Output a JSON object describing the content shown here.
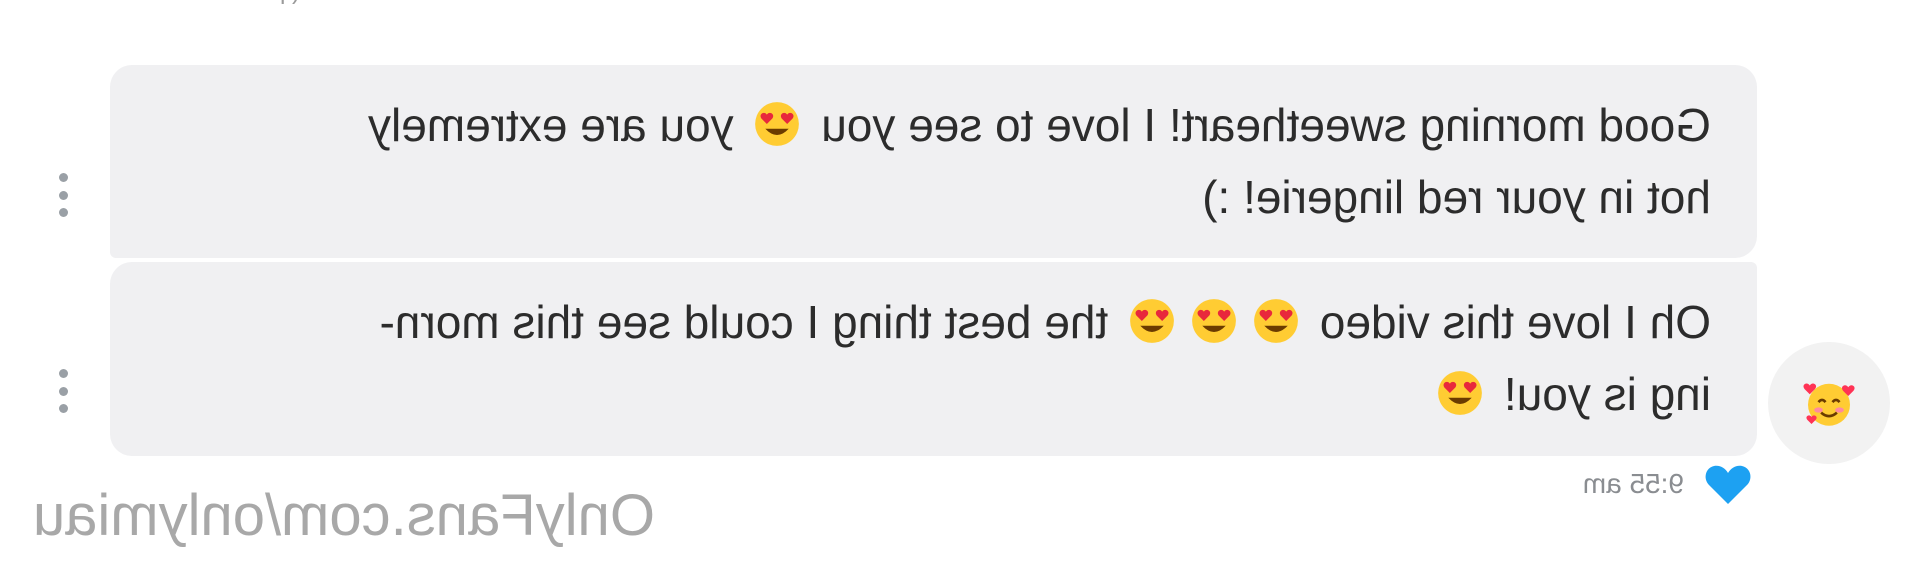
{
  "previous_message_stub": "( p",
  "avatar": {
    "icon": "smiling-face-with-hearts"
  },
  "messages": [
    {
      "text_part1": "Good morning sweetheart! I love to see you",
      "emoji1": "smiling-face-with-heart-eyes",
      "text_part2": "you are extremely",
      "line2": "hot in your red lingerie! :)"
    },
    {
      "text_part1": "Oh I love this video",
      "emojis": [
        "smiling-face-with-heart-eyes",
        "smiling-face-with-heart-eyes",
        "smiling-face-with-heart-eyes"
      ],
      "text_part2": "the best thing I could see this morn-",
      "line2": "ing is you!",
      "emoji_end": "smiling-face-with-heart-eyes"
    }
  ],
  "meta": {
    "timestamp": "9:55 am",
    "heart_icon": "heart-icon",
    "heart_color": "#1da1f2"
  },
  "watermark": "OnlyFans.com/onlymiau",
  "colors": {
    "bubble_bg": "#f0f0f2",
    "text": "#2c2c2c",
    "muted": "#8a8d91"
  }
}
